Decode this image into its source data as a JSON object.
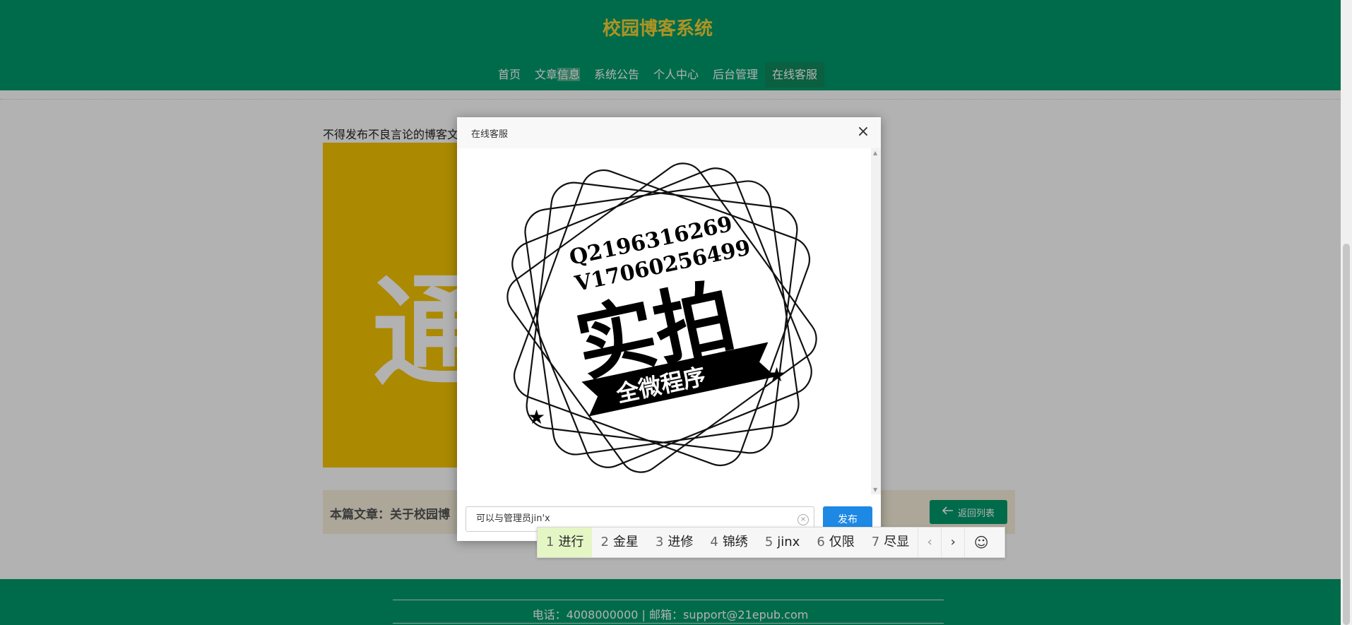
{
  "header": {
    "title": "校园博客系统"
  },
  "nav": [
    {
      "label": "首页"
    },
    {
      "label_a": "文章",
      "label_b": "信息"
    },
    {
      "label": "系统公告"
    },
    {
      "label": "个人中心"
    },
    {
      "label": "后台管理"
    },
    {
      "label": "在线客服"
    }
  ],
  "content": {
    "notice": "不得发布不良言论的博客文",
    "poster_char": "通",
    "article_label": "本篇文章：关于校园博",
    "back_label": "返回列表"
  },
  "footer": {
    "text": "电话：4008000000 | 邮箱：support@21epub.com"
  },
  "dialog": {
    "title": "在线客服",
    "image": {
      "line1": "Q2196316269",
      "line2": "V17060256499",
      "main": "实拍",
      "banner": "全微程序"
    },
    "input_value": "可以与管理员jin'x",
    "send_label": "发布"
  },
  "ime": {
    "candidates": [
      {
        "n": "1",
        "text": "进行"
      },
      {
        "n": "2",
        "text": "金星"
      },
      {
        "n": "3",
        "text": "进修"
      },
      {
        "n": "4",
        "text": "锦绣"
      },
      {
        "n": "5",
        "text": "jinx"
      },
      {
        "n": "6",
        "text": "仅限"
      },
      {
        "n": "7",
        "text": "尽显"
      }
    ],
    "prev": "‹",
    "next": "›",
    "emoji": "☺"
  },
  "colors": {
    "primary": "#009a6a",
    "title": "#f6d336",
    "send": "#1e88e5"
  }
}
